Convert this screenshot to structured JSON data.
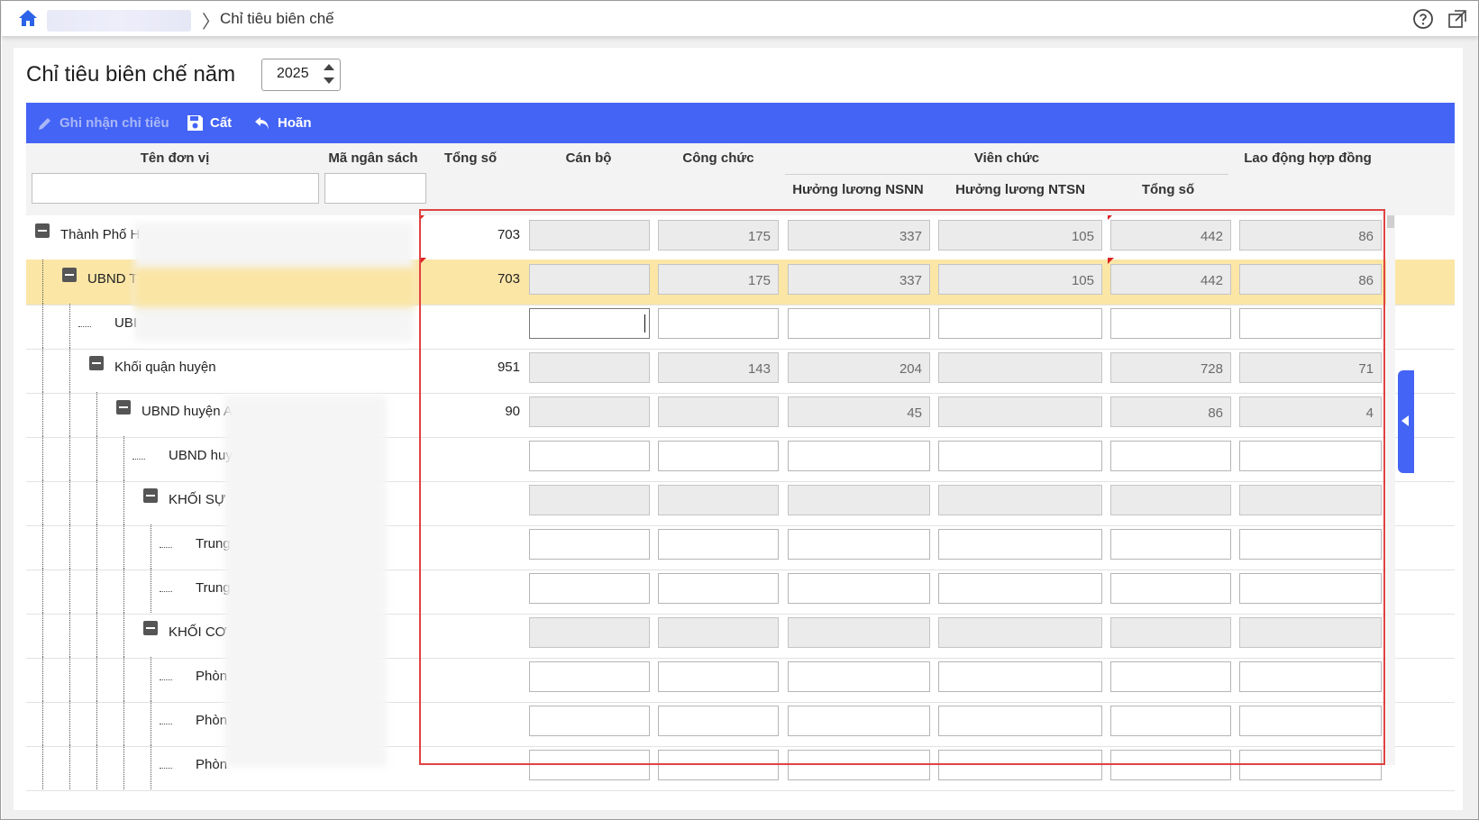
{
  "breadcrumb": {
    "current": "Chỉ tiêu biên chế"
  },
  "page": {
    "title": "Chỉ tiêu biên chế năm",
    "year": "2025"
  },
  "toolbar": {
    "record_label": "Ghi nhận chỉ tiêu",
    "save_label": "Cất",
    "undo_label": "Hoãn"
  },
  "columns": {
    "unit_name": "Tên đơn vị",
    "budget_code": "Mã ngân sách",
    "total": "Tổng số",
    "can_bo": "Cán bộ",
    "cong_chuc": "Công chức",
    "vien_chuc": "Viên chức",
    "vc_nsnn": "Hưởng lương NSNN",
    "vc_ntsn": "Hưởng lương NTSN",
    "vc_total": "Tổng số",
    "lao_dong": "Lao động hợp đồng"
  },
  "rows": [
    {
      "name": "Thành Phố H",
      "total": "703",
      "can_bo": "",
      "cong_chuc": "175",
      "vc_nsnn": "337",
      "vc_ntsn": "105",
      "vc_total": "442",
      "lao_dong": "86"
    },
    {
      "name": "UBND T",
      "total": "703",
      "can_bo": "",
      "cong_chuc": "175",
      "vc_nsnn": "337",
      "vc_ntsn": "105",
      "vc_total": "442",
      "lao_dong": "86"
    },
    {
      "name": "UBI",
      "total": "",
      "can_bo": "",
      "cong_chuc": "",
      "vc_nsnn": "",
      "vc_ntsn": "",
      "vc_total": "",
      "lao_dong": ""
    },
    {
      "name": "Khối quận huyện",
      "total": "951",
      "can_bo": "",
      "cong_chuc": "143",
      "vc_nsnn": "204",
      "vc_ntsn": "",
      "vc_total": "728",
      "lao_dong": "71"
    },
    {
      "name": "UBND huyện A",
      "total": "90",
      "can_bo": "",
      "cong_chuc": "",
      "vc_nsnn": "45",
      "vc_ntsn": "",
      "vc_total": "86",
      "lao_dong": "4"
    },
    {
      "name": "UBND huy",
      "total": "",
      "can_bo": "",
      "cong_chuc": "",
      "vc_nsnn": "",
      "vc_ntsn": "",
      "vc_total": "",
      "lao_dong": ""
    },
    {
      "name": "KHỐI SỰ",
      "total": "",
      "can_bo": "",
      "cong_chuc": "",
      "vc_nsnn": "",
      "vc_ntsn": "",
      "vc_total": "",
      "lao_dong": ""
    },
    {
      "name": "Trung",
      "total": "",
      "can_bo": "",
      "cong_chuc": "",
      "vc_nsnn": "",
      "vc_ntsn": "",
      "vc_total": "",
      "lao_dong": ""
    },
    {
      "name": "Trung",
      "total": "",
      "can_bo": "",
      "cong_chuc": "",
      "vc_nsnn": "",
      "vc_ntsn": "",
      "vc_total": "",
      "lao_dong": ""
    },
    {
      "name": "KHỐI CƠ",
      "total": "",
      "can_bo": "",
      "cong_chuc": "",
      "vc_nsnn": "",
      "vc_ntsn": "",
      "vc_total": "",
      "lao_dong": ""
    },
    {
      "name": "Phòn",
      "total": "",
      "can_bo": "",
      "cong_chuc": "",
      "vc_nsnn": "",
      "vc_ntsn": "",
      "vc_total": "",
      "lao_dong": ""
    },
    {
      "name": "Phòn",
      "total": "",
      "can_bo": "",
      "cong_chuc": "",
      "vc_nsnn": "",
      "vc_ntsn": "",
      "vc_total": "",
      "lao_dong": ""
    },
    {
      "name": "Phòn",
      "total": "",
      "can_bo": "",
      "cong_chuc": "",
      "vc_nsnn": "",
      "vc_ntsn": "",
      "vc_total": "",
      "lao_dong": ""
    }
  ],
  "colors": {
    "toolbar": "#4464f5",
    "selected_row": "#fbe6a6",
    "highlight_border": "#e04343"
  }
}
